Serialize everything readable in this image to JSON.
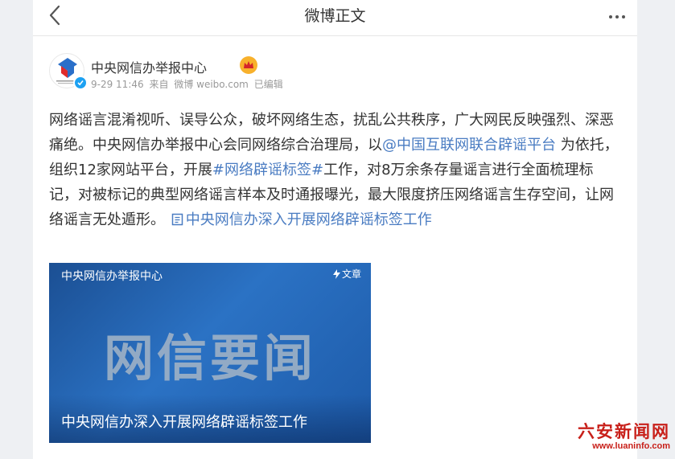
{
  "topbar": {
    "title": "微博正文",
    "back_icon": "chevron-left-icon",
    "more_icon": "more-dots-icon"
  },
  "post": {
    "author": "中央网信办举报中心",
    "time": "9-29 11:46",
    "source_prefix": "来自",
    "source": "微博 weibo.com",
    "edited": "已编辑",
    "text_1": "网络谣言混淆视听、误导公众，破坏网络生态，扰乱公共秩序，广大网民反映强烈、深恶痛绝。中央网信办举报中心会同网络综合治理局，以",
    "mention": "@中国互联网联合辟谣平台",
    "text_2": " 为依托，组织12家网站平台，开展",
    "hashtag": "#网络辟谣标签#",
    "text_3": "工作，对8万余条存量谣言进行全面梳理标记，对被标记的典型网络谣言样本及时通报曝光，最大限度挤压网络谣言生存空间，让网络谣言无处遁形。",
    "article_link": "中央网信办深入开展网络辟谣标签工作"
  },
  "card": {
    "source": "中央网信办举报中心",
    "type": "文章",
    "big_text": "网信要闻",
    "title": "中央网信办深入开展网络辟谣标签工作"
  },
  "watermark": {
    "logo": "六安新闻网",
    "url": "www.luaninfo.com"
  },
  "colors": {
    "link": "#4a7cc2",
    "card_bg": "#2b72c4",
    "badge": "#f8b12c",
    "verified": "#1da1f2",
    "watermark": "#c8201a"
  }
}
